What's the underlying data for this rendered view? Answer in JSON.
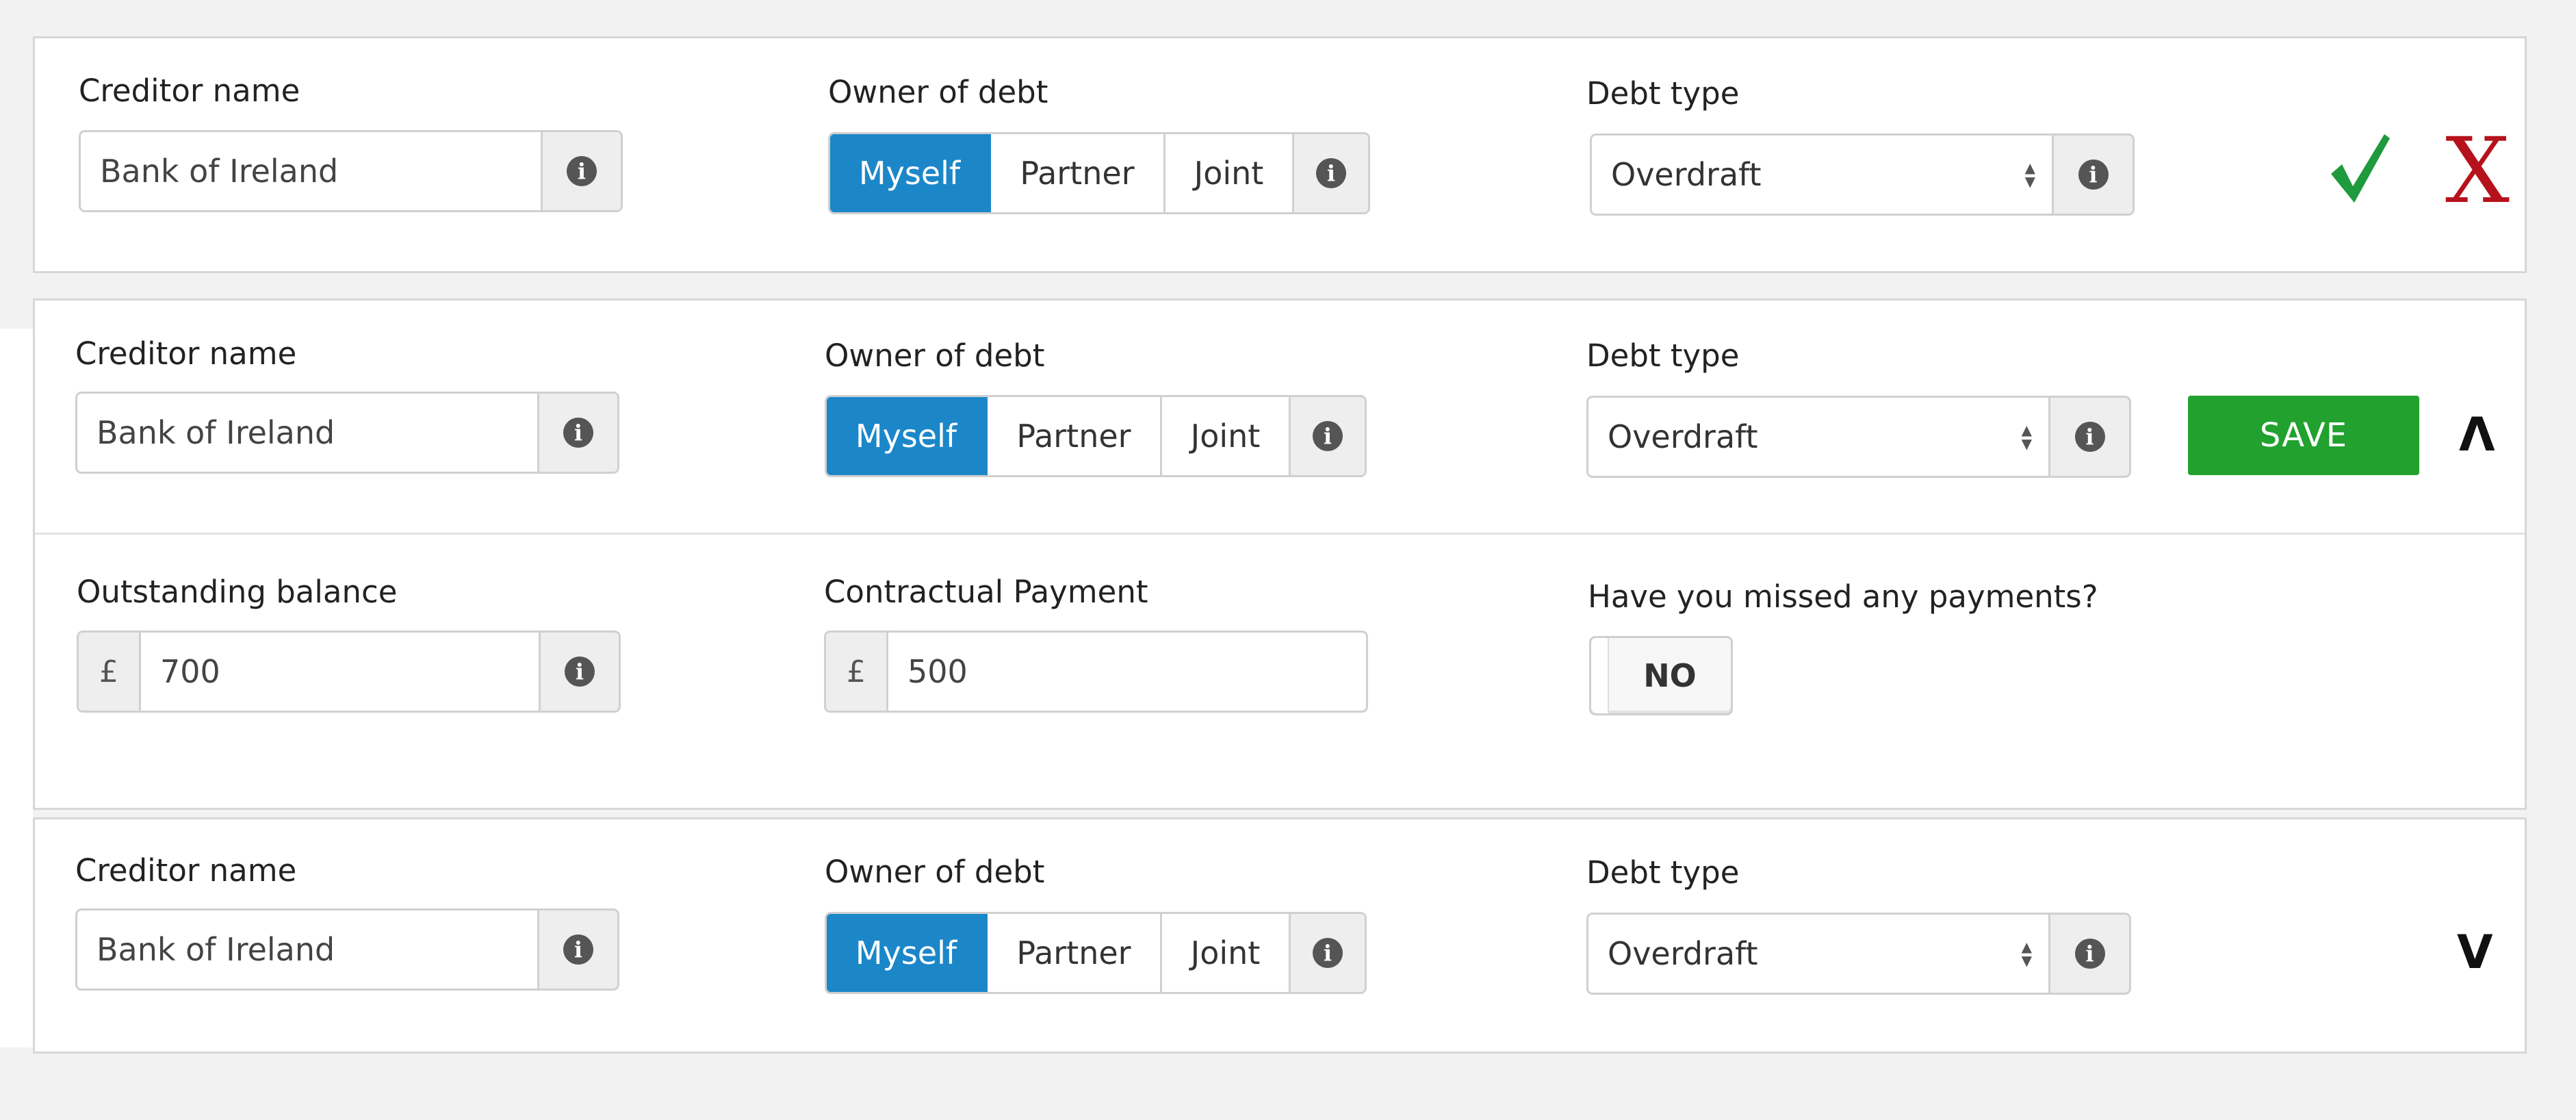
{
  "labels": {
    "creditor_name": "Creditor name",
    "owner_of_debt": "Owner of debt",
    "debt_type": "Debt type",
    "outstanding_balance": "Outstanding balance",
    "contractual_payment": "Contractual Payment",
    "missed_payments": "Have you missed any payments?"
  },
  "owner_options": [
    "Myself",
    "Partner",
    "Joint"
  ],
  "info_glyph": "i",
  "currency_symbol": "£",
  "rows": [
    {
      "creditor": "Bank of Ireland",
      "owner_selected": "Myself",
      "debt_type": "Overdraft",
      "actions": "confirm-cancel"
    },
    {
      "creditor": "Bank of Ireland",
      "owner_selected": "Myself",
      "debt_type": "Overdraft",
      "actions": "save-collapse",
      "save_label": "SAVE",
      "collapse_glyph": "Λ",
      "outstanding_balance": "700",
      "contractual_payment": "500",
      "missed_payments_toggle": "NO"
    },
    {
      "creditor": "Bank of Ireland",
      "owner_selected": "Myself",
      "debt_type": "Overdraft",
      "actions": "expand",
      "expand_glyph": "V"
    }
  ],
  "cancel_glyph": "X",
  "colors": {
    "selected_segment": "#1b87c9",
    "save_button": "#22a12f",
    "confirm_check": "#1f9a3c",
    "cancel_x": "#b5121b"
  },
  "icons": [
    "info-icon",
    "checkmark-icon",
    "close-icon",
    "chevron-up-icon",
    "chevron-down-icon",
    "select-arrows-icon"
  ]
}
